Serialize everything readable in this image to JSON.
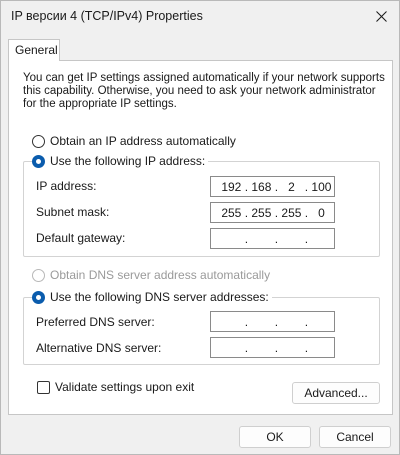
{
  "window": {
    "title": "IP версии 4 (TCP/IPv4) Properties"
  },
  "tabs": [
    {
      "label": "General"
    }
  ],
  "description": "You can get IP settings assigned automatically if your network supports this capability. Otherwise, you need to ask your network administrator for the appropriate IP settings.",
  "ip_section": {
    "auto_label": "Obtain an IP address automatically",
    "auto_selected": false,
    "manual_label": "Use the following IP address:",
    "manual_selected": true,
    "fields": [
      {
        "label": "IP address:",
        "octets": [
          "192",
          "168",
          "2",
          "100"
        ]
      },
      {
        "label": "Subnet mask:",
        "octets": [
          "255",
          "255",
          "255",
          "0"
        ]
      },
      {
        "label": "Default gateway:",
        "octets": [
          "",
          "",
          "",
          ""
        ]
      }
    ]
  },
  "dns_section": {
    "auto_label": "Obtain DNS server address automatically",
    "auto_enabled": false,
    "manual_label": "Use the following DNS server addresses:",
    "manual_selected": true,
    "fields": [
      {
        "label": "Preferred DNS server:",
        "octets": [
          "",
          "",
          "",
          ""
        ]
      },
      {
        "label": "Alternative DNS server:",
        "octets": [
          "",
          "",
          "",
          ""
        ]
      }
    ]
  },
  "validate": {
    "label": "Validate settings upon exit",
    "checked": false
  },
  "buttons": {
    "advanced": "Advanced...",
    "ok": "OK",
    "cancel": "Cancel"
  },
  "colors": {
    "accent": "#0b5cad",
    "window_bg": "#f0f0f0",
    "panel_bg": "#ffffff",
    "disabled_text": "#9a9a9a"
  }
}
